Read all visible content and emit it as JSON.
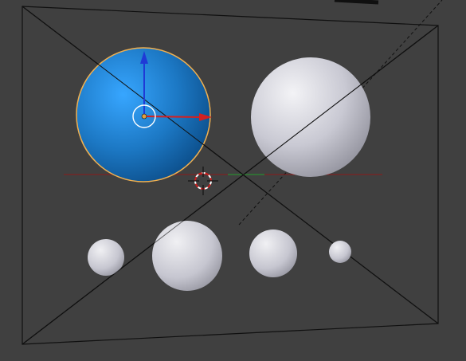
{
  "viewport": {
    "background_color": "#404040",
    "frame_line_color": "#111111",
    "red_axis_color": "#8b1a1a",
    "green_axis_color": "#2e7d32"
  },
  "selected_object": {
    "name": "sphere",
    "fill_primary": "#2f9ae0",
    "fill_shadow": "#0a4f8a",
    "outline_color": "#f0b050"
  },
  "gizmo": {
    "x_axis_color": "#d42020",
    "z_axis_color": "#1f3ad6",
    "center_ring_color": "#ffffff"
  },
  "icons": {
    "cursor": "3d-cursor-icon",
    "gizmo": "transform-gizmo-icon"
  }
}
